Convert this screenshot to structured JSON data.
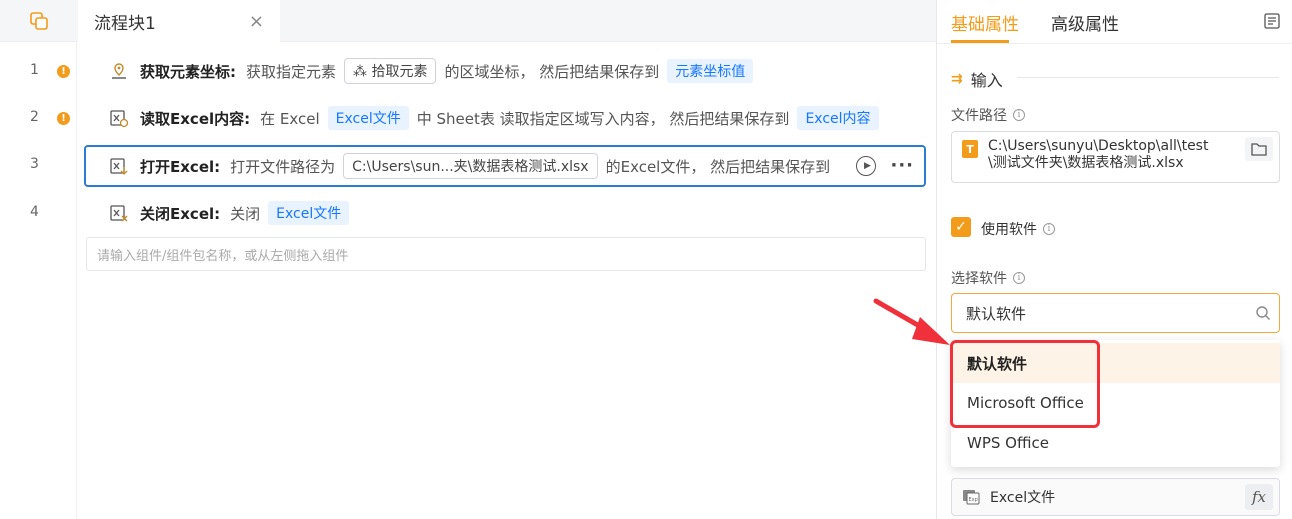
{
  "tab": {
    "title": "流程块1",
    "close": "×"
  },
  "lines": [
    {
      "num": "1",
      "warn": "!"
    },
    {
      "num": "2",
      "warn": "!"
    },
    {
      "num": "3",
      "warn": ""
    },
    {
      "num": "4",
      "warn": ""
    }
  ],
  "rows": {
    "r1": {
      "title": "获取元素坐标:",
      "t1": "获取指定元素",
      "pick": "拾取元素",
      "t2": "的区域坐标， 然后把结果保存到",
      "out": "元素坐标值"
    },
    "r2": {
      "title": "读取Excel内容:",
      "t1": "在 Excel",
      "chip": "Excel文件",
      "t2": "中 Sheet表  读取指定区域写入内容， 然后把结果保存到",
      "out": "Excel内容"
    },
    "r3": {
      "title": "打开Excel:",
      "t1": "打开文件路径为",
      "path": "C:\\Users\\sun...夹\\数据表格测试.xlsx",
      "t2": "的Excel文件， 然后把结果保存到"
    },
    "r4": {
      "title": "关闭Excel:",
      "t1": "关闭",
      "chip": "Excel文件"
    }
  },
  "add_placeholder": "请输入组件/组件包名称，或从左侧拖入组件",
  "panel": {
    "tab_basic": "基础属性",
    "tab_advanced": "高级属性",
    "section_input": "输入",
    "file_path_label": "文件路径",
    "file_path_value_1": "C:\\Users\\sunyu\\Desktop\\all\\test",
    "file_path_value_2": "\\测试文件夹\\数据表格测试.xlsx",
    "use_software_label": "使用软件",
    "select_software_label": "选择软件",
    "select_value": "默认软件",
    "options": [
      "默认软件",
      "Microsoft Office",
      "WPS Office"
    ],
    "output_var": "Excel文件",
    "fx": "fx"
  },
  "colors": {
    "accent": "#f39b1a",
    "blue": "#1677ff",
    "annotation": "#f0303a"
  }
}
